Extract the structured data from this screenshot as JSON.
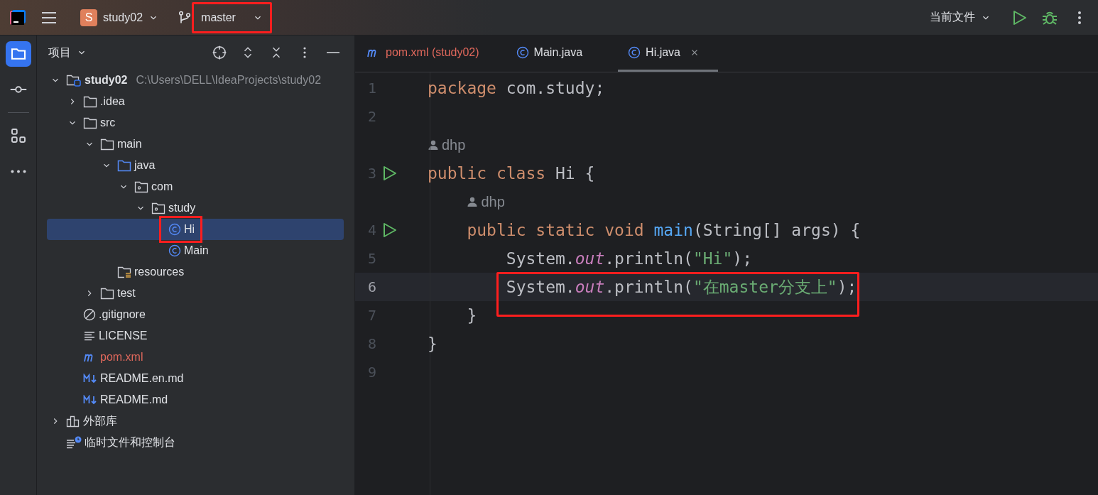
{
  "toolbar": {
    "project": {
      "badge": "S",
      "name": "study02"
    },
    "branch": {
      "name": "master",
      "highlighted": true
    },
    "run_config": "当前文件"
  },
  "sidebar": {
    "items": [
      {
        "kind": "project",
        "selected": true
      },
      {
        "kind": "commit",
        "selected": false
      },
      {
        "kind": "structure",
        "selected": false
      },
      {
        "kind": "more",
        "selected": false
      }
    ]
  },
  "project_panel": {
    "title": "项目",
    "tree": [
      {
        "name": "study02",
        "kind": "module",
        "path": "C:\\Users\\DELL\\IdeaProjects\\study02",
        "expanded": true,
        "selected": false,
        "children": [
          {
            "name": ".idea",
            "kind": "folder",
            "expanded": false,
            "selected": false
          },
          {
            "name": "src",
            "kind": "folder",
            "expanded": true,
            "selected": false,
            "children": [
              {
                "name": "main",
                "kind": "folder",
                "expanded": true,
                "selected": false,
                "children": [
                  {
                    "name": "java",
                    "kind": "source",
                    "expanded": true,
                    "selected": false,
                    "children": [
                      {
                        "name": "com",
                        "kind": "package",
                        "expanded": true,
                        "selected": false,
                        "children": [
                          {
                            "name": "study",
                            "kind": "package",
                            "expanded": true,
                            "selected": false,
                            "children": [
                              {
                                "name": "Hi",
                                "kind": "class",
                                "selected": true,
                                "highlighted": true
                              },
                              {
                                "name": "Main",
                                "kind": "class",
                                "selected": false
                              }
                            ]
                          }
                        ]
                      }
                    ]
                  },
                  {
                    "name": "resources",
                    "kind": "resources",
                    "selected": false
                  }
                ]
              },
              {
                "name": "test",
                "kind": "folder",
                "expanded": false,
                "selected": false
              }
            ]
          },
          {
            "name": ".gitignore",
            "kind": "ignore",
            "selected": false
          },
          {
            "name": "LICENSE",
            "kind": "text",
            "selected": false
          },
          {
            "name": "pom.xml",
            "kind": "maven",
            "selected": false,
            "modified": true
          },
          {
            "name": "README.en.md",
            "kind": "markdown",
            "selected": false
          },
          {
            "name": "README.md",
            "kind": "markdown",
            "selected": false
          }
        ]
      },
      {
        "name": "外部库",
        "kind": "library",
        "expanded": false,
        "selected": false
      },
      {
        "name": "临时文件和控制台",
        "kind": "scratch",
        "selected": false
      }
    ]
  },
  "editor": {
    "tabs": [
      {
        "label": "pom.xml (study02)",
        "kind": "maven",
        "modified": true,
        "selected": false
      },
      {
        "label": "Main.java",
        "kind": "class",
        "selected": false
      },
      {
        "label": "Hi.java",
        "kind": "class",
        "selected": true
      }
    ],
    "rows": [
      {
        "kind": "code",
        "number": "1",
        "tokens": [
          {
            "kind": "keyword",
            "text": "package"
          },
          {
            "kind": "plain",
            "text": " com.study;"
          }
        ]
      },
      {
        "kind": "code",
        "number": "2"
      },
      {
        "kind": "author",
        "text": "dhp"
      },
      {
        "kind": "code",
        "number": "3",
        "runnable": true,
        "tokens": [
          {
            "kind": "keyword",
            "text": "public class"
          },
          {
            "kind": "plain",
            "text": " Hi {"
          }
        ]
      },
      {
        "kind": "author",
        "text": "dhp"
      },
      {
        "kind": "code",
        "number": "4",
        "runnable": true,
        "tokens": [
          {
            "kind": "keyword",
            "text": "    public static void "
          },
          {
            "kind": "method",
            "text": "main"
          },
          {
            "kind": "plain",
            "text": "(String[] args) {"
          }
        ]
      },
      {
        "kind": "code",
        "number": "5",
        "tokens": [
          {
            "kind": "plain",
            "text": "        System."
          },
          {
            "kind": "field",
            "text": "out"
          },
          {
            "kind": "plain",
            "text": ".println("
          },
          {
            "kind": "string",
            "text": "\"Hi\""
          },
          {
            "kind": "plain",
            "text": ");"
          }
        ]
      },
      {
        "kind": "code",
        "number": "6",
        "current": true,
        "highlighted": true,
        "tokens": [
          {
            "kind": "plain",
            "text": "        System."
          },
          {
            "kind": "field",
            "text": "out"
          },
          {
            "kind": "plain",
            "text": ".println("
          },
          {
            "kind": "string",
            "text": "\"在master分支上\""
          },
          {
            "kind": "plain",
            "text": ");"
          }
        ]
      },
      {
        "kind": "code",
        "number": "7",
        "tokens": [
          {
            "kind": "plain",
            "text": "    }"
          }
        ]
      },
      {
        "kind": "code",
        "number": "8",
        "tokens": [
          {
            "kind": "plain",
            "text": "}"
          }
        ]
      },
      {
        "kind": "code",
        "number": "9"
      }
    ]
  }
}
